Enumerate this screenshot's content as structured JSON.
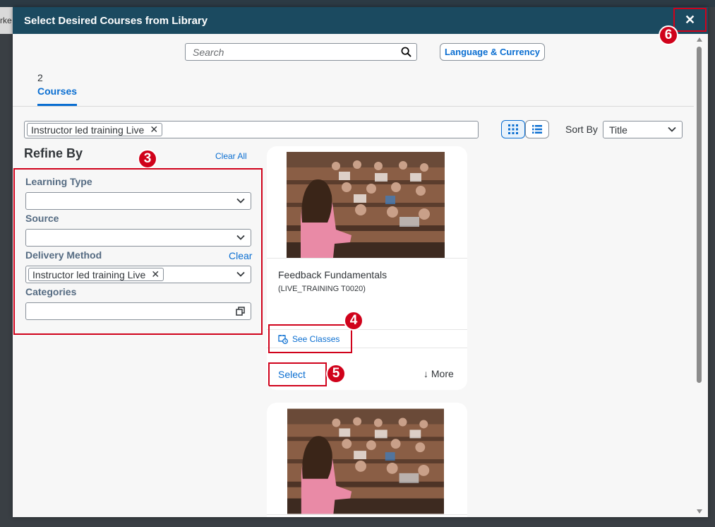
{
  "background": {
    "partial_text": "rke"
  },
  "dialog": {
    "title": "Select Desired Courses from Library",
    "close_glyph": "✕"
  },
  "callouts": [
    "3",
    "4",
    "5",
    "6"
  ],
  "search": {
    "placeholder": "Search",
    "value": ""
  },
  "language_currency_label": "Language & Currency",
  "tabs": [
    {
      "count": "2",
      "label": "Courses"
    }
  ],
  "active_filter": {
    "token": "Instructor led training Live",
    "remove_glyph": "✕"
  },
  "view_toggle": {
    "grid_icon": "grid-icon",
    "list_icon": "list-icon",
    "active": "grid"
  },
  "sort": {
    "label": "Sort By",
    "value": "Title"
  },
  "refine": {
    "title": "Refine By",
    "clear_all": "Clear All",
    "fields": {
      "learning_type": {
        "label": "Learning Type",
        "value": ""
      },
      "source": {
        "label": "Source",
        "value": ""
      },
      "delivery_method": {
        "label": "Delivery Method",
        "clear": "Clear",
        "token": "Instructor led training Live"
      },
      "categories": {
        "label": "Categories",
        "value": ""
      }
    }
  },
  "cards": [
    {
      "title": "Feedback Fundamentals",
      "code": "(LIVE_TRAINING T0020)",
      "see_classes": "See Classes",
      "select": "Select",
      "more": "↓ More"
    }
  ],
  "colors": {
    "header": "#1b4a60",
    "accent": "#0a6ed1",
    "callout": "#d0021b",
    "dialog_bg": "#f7f7f7"
  }
}
